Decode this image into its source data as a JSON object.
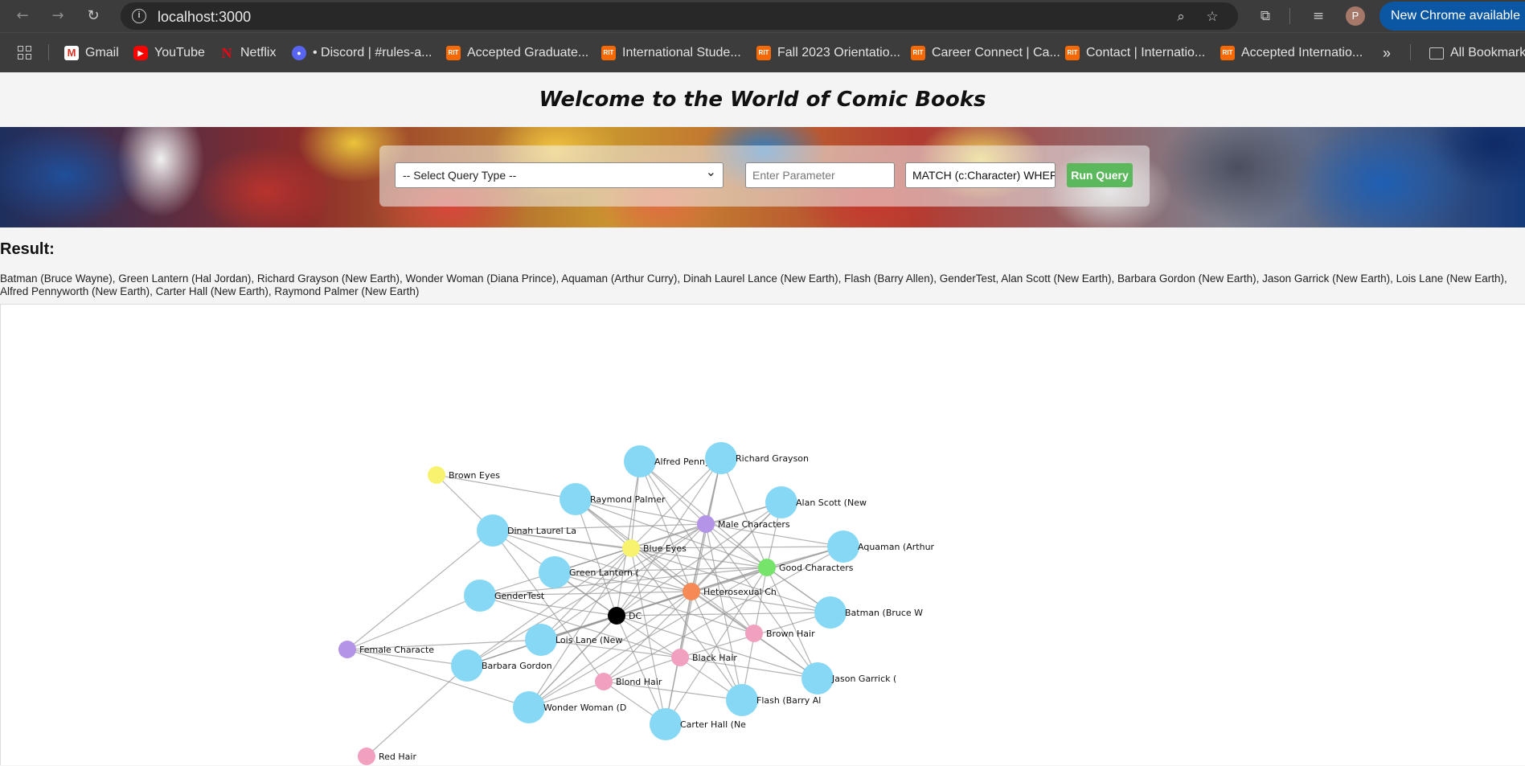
{
  "browser": {
    "url": "localhost:3000",
    "update_label": "New Chrome available",
    "profile_initial": "P",
    "bookmarks": [
      {
        "label": "Gmail",
        "icon": "gmail-icon",
        "glyph": "M"
      },
      {
        "label": "YouTube",
        "icon": "youtube-icon",
        "glyph": "▶"
      },
      {
        "label": "Netflix",
        "icon": "netflix-icon",
        "glyph": "N"
      },
      {
        "label": "• Discord | #rules-a...",
        "icon": "discord-icon",
        "glyph": "●"
      },
      {
        "label": "Accepted Graduate...",
        "icon": "rit-icon",
        "glyph": "RIT"
      },
      {
        "label": "International Stude...",
        "icon": "rit-icon",
        "glyph": "RIT"
      },
      {
        "label": "Fall 2023 Orientatio...",
        "icon": "rit-icon",
        "glyph": "RIT"
      },
      {
        "label": "Career Connect | Ca...",
        "icon": "rit-icon",
        "glyph": "RIT"
      },
      {
        "label": "Contact | Internatio...",
        "icon": "rit-icon",
        "glyph": "RIT"
      },
      {
        "label": "Accepted Internatio...",
        "icon": "rit-icon",
        "glyph": "RIT"
      }
    ],
    "more_label": "»",
    "all_bookmarks_label": "All Bookmarks"
  },
  "page": {
    "title": "Welcome to the World of Comic Books",
    "query": {
      "select_value": "-- Select Query Type --",
      "param_placeholder": "Enter Parameter",
      "cypher_value": "MATCH (c:Character) WHEF",
      "run_label": "Run Query"
    },
    "result_heading": "Result:",
    "result_text": "Batman (Bruce Wayne), Green Lantern (Hal Jordan), Richard Grayson (New Earth), Wonder Woman (Diana Prince), Aquaman (Arthur Curry), Dinah Laurel Lance (New Earth), Flash (Barry Allen), GenderTest, Alan Scott (New Earth), Barbara Gordon (New Earth), Jason Garrick (New Earth), Lois Lane (New Earth), Alfred Pennyworth (New Earth), Carter Hall (New Earth), Raymond Palmer (New Earth)"
  },
  "colors": {
    "character": "#87d8f5",
    "eyes": "#f7f36e",
    "gender": "#b394e6",
    "alignment": "#76e36a",
    "orientation": "#f58a57",
    "universe": "#000000",
    "hair": "#f2a0bf",
    "edge": "#9a9a9a"
  },
  "graph": {
    "nodes": [
      {
        "id": "alfred",
        "label": "Alfred Pennywor",
        "group": "character"
      },
      {
        "id": "richard",
        "label": "Richard Grayson",
        "group": "character"
      },
      {
        "id": "raymond",
        "label": "Raymond Palmer",
        "group": "character"
      },
      {
        "id": "alan",
        "label": "Alan Scott (New",
        "group": "character"
      },
      {
        "id": "dinah",
        "label": "Dinah Laurel La",
        "group": "character"
      },
      {
        "id": "aquaman",
        "label": "Aquaman (Arthur",
        "group": "character"
      },
      {
        "id": "green",
        "label": "Green Lantern (",
        "group": "character"
      },
      {
        "id": "gendertest",
        "label": "GenderTest",
        "group": "character"
      },
      {
        "id": "batman",
        "label": "Batman (Bruce W",
        "group": "character"
      },
      {
        "id": "lois",
        "label": "Lois Lane (New",
        "group": "character"
      },
      {
        "id": "barbara",
        "label": "Barbara Gordon",
        "group": "character"
      },
      {
        "id": "jason",
        "label": "Jason Garrick (",
        "group": "character"
      },
      {
        "id": "flash",
        "label": "Flash (Barry Al",
        "group": "character"
      },
      {
        "id": "wonder",
        "label": "Wonder Woman (D",
        "group": "character"
      },
      {
        "id": "carter",
        "label": "Carter Hall (Ne",
        "group": "character"
      },
      {
        "id": "browneyes",
        "label": "Brown Eyes",
        "group": "eyes"
      },
      {
        "id": "blueeyes",
        "label": "Blue Eyes",
        "group": "eyes"
      },
      {
        "id": "male",
        "label": "Male Characters",
        "group": "gender"
      },
      {
        "id": "female",
        "label": "Female Characte",
        "group": "gender"
      },
      {
        "id": "good",
        "label": "Good Characters",
        "group": "alignment"
      },
      {
        "id": "hetero",
        "label": "Heterosexual Ch",
        "group": "orientation"
      },
      {
        "id": "dc",
        "label": "DC",
        "group": "universe"
      },
      {
        "id": "brownhair",
        "label": "Brown Hair",
        "group": "hair"
      },
      {
        "id": "blackhair",
        "label": "Black Hair",
        "group": "hair"
      },
      {
        "id": "blondhair",
        "label": "Blond Hair",
        "group": "hair"
      },
      {
        "id": "redhair",
        "label": "Red Hair",
        "group": "hair"
      }
    ]
  }
}
